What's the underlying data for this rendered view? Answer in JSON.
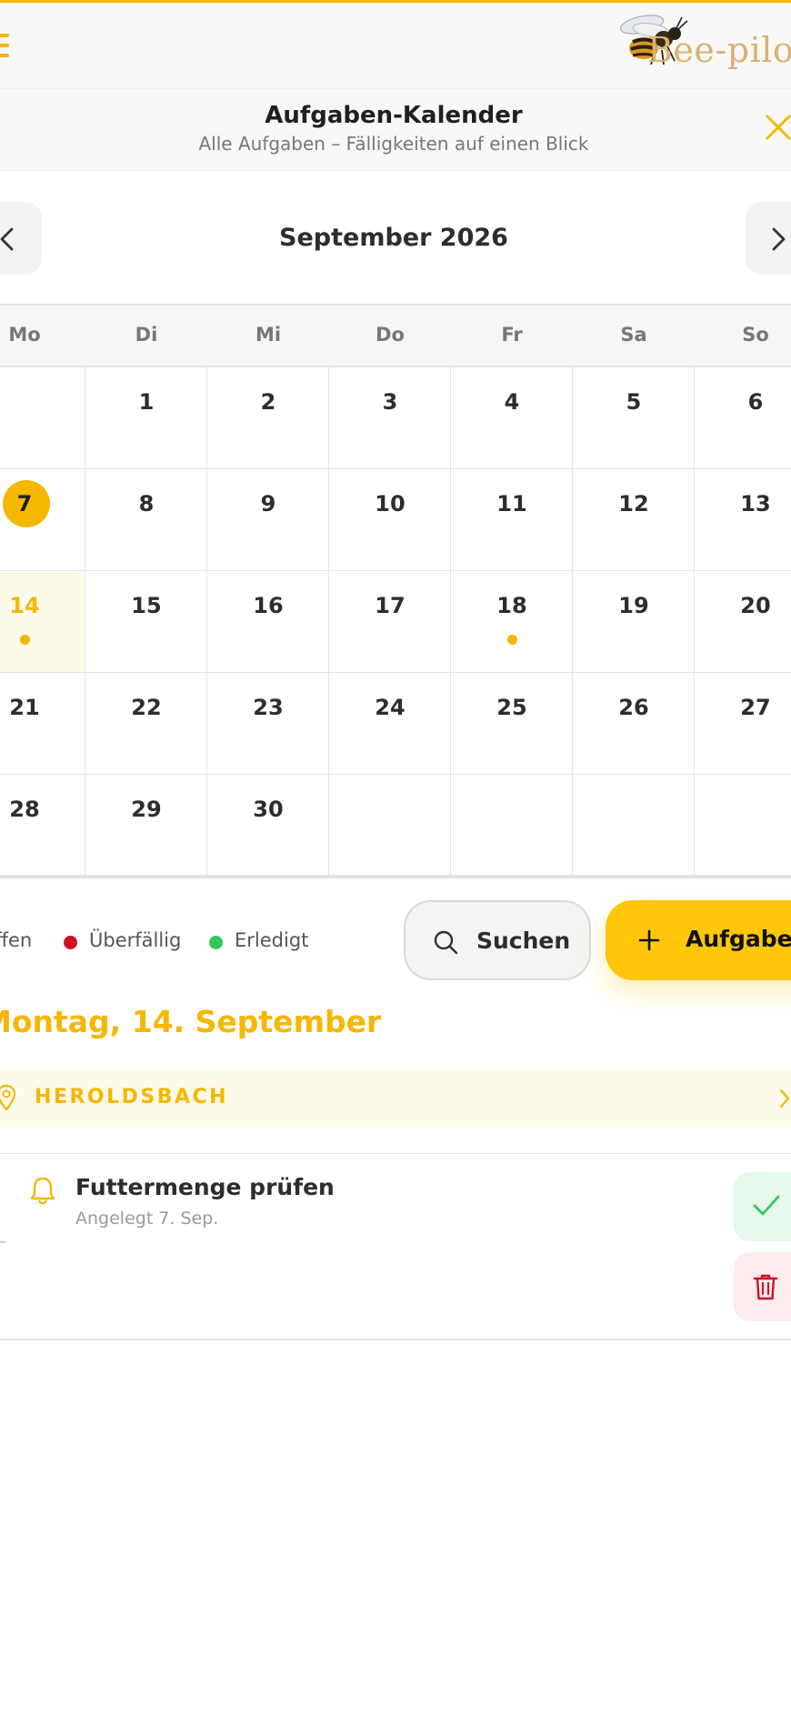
{
  "app": {
    "logo_text": "Bee-pilot"
  },
  "header": {
    "title": "Aufgaben-Kalender",
    "subtitle": "Alle Aufgaben – Fälligkeiten auf einen Blick"
  },
  "calendar": {
    "month_label": "September 2026",
    "weekdays": [
      "Mo",
      "Di",
      "Mi",
      "Do",
      "Fr",
      "Sa",
      "So"
    ],
    "weeks": [
      [
        "",
        "1",
        "2",
        "3",
        "4",
        "5",
        "6"
      ],
      [
        "7",
        "8",
        "9",
        "10",
        "11",
        "12",
        "13"
      ],
      [
        "14",
        "15",
        "16",
        "17",
        "18",
        "19",
        "20"
      ],
      [
        "21",
        "22",
        "23",
        "24",
        "25",
        "26",
        "27"
      ],
      [
        "28",
        "29",
        "30",
        "",
        "",
        "",
        ""
      ]
    ],
    "today": "7",
    "selected": "14",
    "days_with_tasks": [
      "14",
      "18"
    ]
  },
  "legend": [
    {
      "label": "Offen",
      "color": "#f5b700"
    },
    {
      "label": "Überfällig",
      "color": "#cc1126"
    },
    {
      "label": "Erledigt",
      "color": "#34c759"
    }
  ],
  "actions": {
    "search_label": "Suchen",
    "add_label": "Aufgabe"
  },
  "selected_day": {
    "heading": "Montag, 14. September",
    "location": "HEROLDSBACH",
    "tasks": [
      {
        "title": "Futtermenge prüfen",
        "meta": "Angelegt 7. Sep."
      }
    ]
  },
  "colors": {
    "accent": "#f5b700",
    "accent_button": "#ffc60a",
    "danger": "#cc1126",
    "success": "#34c759"
  }
}
